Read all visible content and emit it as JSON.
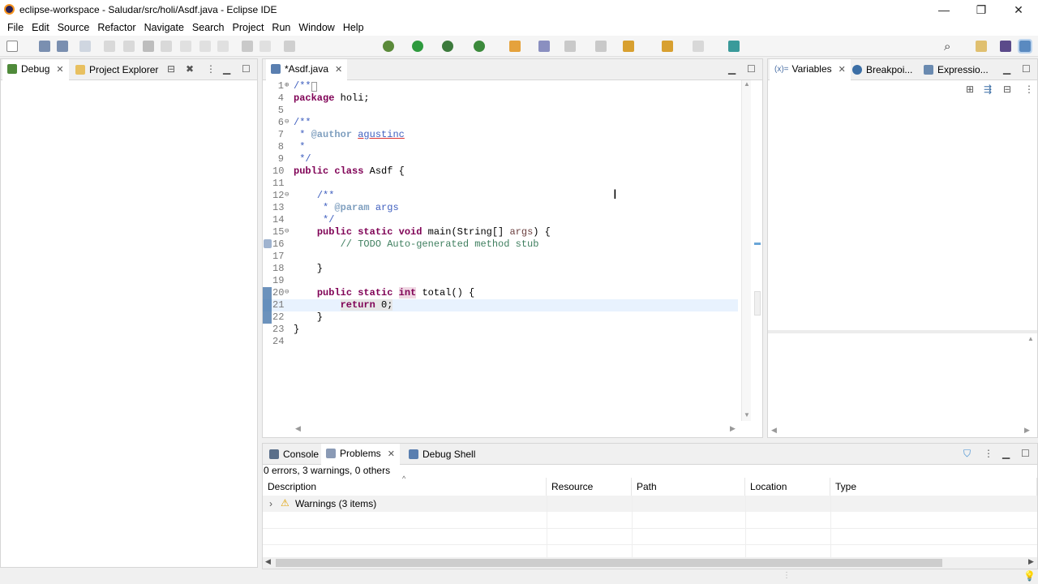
{
  "window": {
    "title": "eclipse-workspace - Saludar/src/holi/Asdf.java - Eclipse IDE",
    "minimize": "—",
    "restore": "❐",
    "close": "✕"
  },
  "menu": [
    "File",
    "Edit",
    "Source",
    "Refactor",
    "Navigate",
    "Search",
    "Project",
    "Run",
    "Window",
    "Help"
  ],
  "left_panel": {
    "tabs": [
      {
        "label": "Debug",
        "close": "✕"
      },
      {
        "label": "Project Explorer"
      }
    ]
  },
  "editor": {
    "tab_label": "*Asdf.java",
    "tab_close": "✕",
    "lines": [
      {
        "n": "1",
        "fold": "⊕",
        "html": "<span class=\"cm\">/**</span><span style=\"border:1px solid #999;font-size:9px\">&nbsp;</span>"
      },
      {
        "n": "4",
        "fold": "",
        "html": "<span class=\"kw\">package</span> holi;"
      },
      {
        "n": "5",
        "fold": "",
        "html": ""
      },
      {
        "n": "6",
        "fold": "⊖",
        "html": "<span class=\"cm\">/**</span>"
      },
      {
        "n": "7",
        "fold": "",
        "html": "<span class=\"cm\"> * </span><span class=\"tag\">@author</span><span class=\"cm\"> <u style=\"text-decoration-color:#d33\">agustinc</u></span>"
      },
      {
        "n": "8",
        "fold": "",
        "html": "<span class=\"cm\"> *</span>"
      },
      {
        "n": "9",
        "fold": "",
        "html": "<span class=\"cm\"> */</span>"
      },
      {
        "n": "10",
        "fold": "",
        "html": "<span class=\"kw\">public class</span> Asdf {"
      },
      {
        "n": "11",
        "fold": "",
        "html": ""
      },
      {
        "n": "12",
        "fold": "⊖",
        "html": "    <span class=\"cm\">/**</span>"
      },
      {
        "n": "13",
        "fold": "",
        "html": "<span class=\"cm\">     * </span><span class=\"tag\">@param</span><span class=\"cm\"> args</span>"
      },
      {
        "n": "14",
        "fold": "",
        "html": "<span class=\"cm\">     */</span>"
      },
      {
        "n": "15",
        "fold": "⊖",
        "html": "    <span class=\"kw\">public static void</span> main(String[] <span style=\"color:#6a3e3e\">args</span>) {"
      },
      {
        "n": "16",
        "fold": "",
        "html": "        <span class=\"cm2\">// TODO Auto-generated method stub</span>"
      },
      {
        "n": "17",
        "fold": "",
        "html": ""
      },
      {
        "n": "18",
        "fold": "",
        "html": "    }"
      },
      {
        "n": "19",
        "fold": "",
        "html": ""
      },
      {
        "n": "20",
        "fold": "⊖",
        "html": "    <span class=\"kw\">public static</span> <span class=\"kw\" style=\"background:#f0d8e4\">int</span> total() {"
      },
      {
        "n": "21",
        "fold": "",
        "html": "        <span class=\"kw\" style=\"background:#e6e6e6\">return</span><span style=\"background:#e6e6e6\"> 0;</span>"
      },
      {
        "n": "22",
        "fold": "",
        "html": "    }"
      },
      {
        "n": "23",
        "fold": "",
        "html": "}"
      },
      {
        "n": "24",
        "fold": "",
        "html": ""
      }
    ]
  },
  "right_panel": {
    "tabs": [
      {
        "label": "Variables",
        "prefix": "(x)=",
        "close": "✕"
      },
      {
        "label": "Breakpoi..."
      },
      {
        "label": "Expressio..."
      }
    ]
  },
  "bottom_panel": {
    "tabs": [
      {
        "label": "Console"
      },
      {
        "label": "Problems",
        "close": "✕"
      },
      {
        "label": "Debug Shell"
      }
    ],
    "summary": "0 errors, 3 warnings, 0 others",
    "columns": [
      "Description",
      "Resource",
      "Path",
      "Location",
      "Type"
    ],
    "rows": [
      {
        "description": "Warnings (3 items)",
        "expander": "›",
        "warning_icon": "⚠"
      }
    ]
  },
  "colors": {
    "keyword": "#7f0055",
    "javadoc": "#3f5fbf",
    "comment": "#3f7f5f",
    "accent": "#3b6ea5",
    "current_line": "#e8f2fe"
  }
}
